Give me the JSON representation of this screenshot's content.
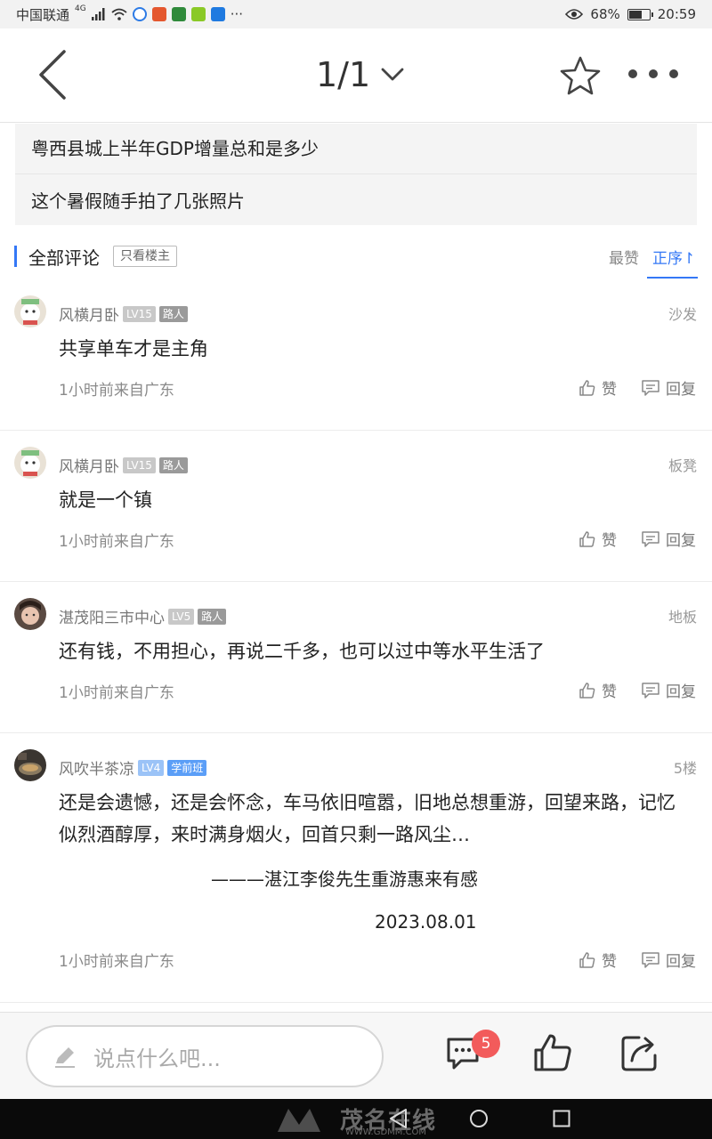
{
  "status": {
    "carrier": "中国联通",
    "network": "4G",
    "battery": "68%",
    "battery_level": 0.68,
    "time": "20:59",
    "more": "···"
  },
  "nav": {
    "pager": "1/1"
  },
  "related": [
    "粤西县城上半年GDP增量总和是多少",
    "这个暑假随手拍了几张照片"
  ],
  "comment_header": {
    "title": "全部评论",
    "owner_only": "只看楼主",
    "sort_hot": "最赞",
    "sort_seq": "正序↾"
  },
  "comments": [
    {
      "user": "风横月卧",
      "level": "LV15",
      "tag": "路人",
      "floor": "沙发",
      "text": "共享单车才是主角",
      "meta": "1小时前来自广东",
      "like": "赞",
      "reply": "回复"
    },
    {
      "user": "风横月卧",
      "level": "LV15",
      "tag": "路人",
      "floor": "板凳",
      "text": "就是一个镇",
      "meta": "1小时前来自广东",
      "like": "赞",
      "reply": "回复"
    },
    {
      "user": "湛茂阳三市中心",
      "level": "LV5",
      "tag": "路人",
      "floor": "地板",
      "text": "还有钱，不用担心，再说二千多，也可以过中等水平生活了",
      "meta": "1小时前来自广东",
      "like": "赞",
      "reply": "回复"
    },
    {
      "user": "风吹半茶凉",
      "level": "LV4",
      "tag": "学前班",
      "floor": "5楼",
      "text": "还是会遗憾，还是会怀念，车马依旧喧嚣，旧地总想重游，回望来路，记忆似烈酒醇厚，来时满身烟火，回首只剩一路风尘…",
      "signature": "———湛江李俊先生重游惠来有感",
      "date": "2023.08.01",
      "meta": "1小时前来自广东",
      "like": "赞",
      "reply": "回复"
    }
  ],
  "bottom": {
    "placeholder": "说点什么吧...",
    "comment_count": "5"
  },
  "watermark": {
    "name": "茂名在线",
    "url": "WWW.GDMM.COM"
  },
  "colors": {
    "accent": "#3478f6",
    "badge": "#f25b5b"
  }
}
